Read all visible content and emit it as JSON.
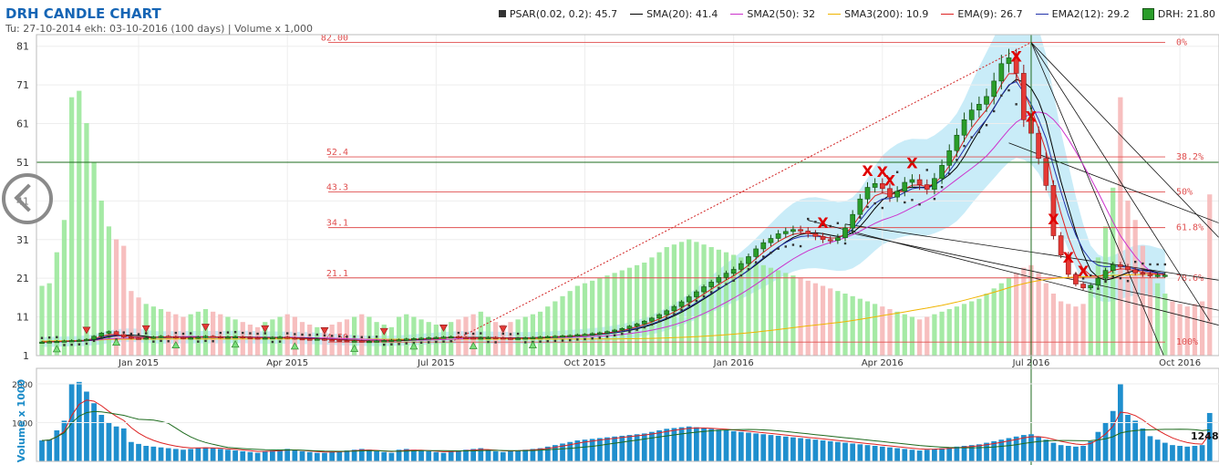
{
  "title": "DRH CANDLE CHART",
  "subtitle": "Tu: 27-10-2014 ekh: 03-10-2016 (100 days) | Volume x 1,000",
  "legend": [
    {
      "label": "PSAR(0.02, 0.2): 45.7",
      "color": "#333333",
      "icon": "square-icon"
    },
    {
      "label": "SMA(20): 41.4",
      "color": "#000000",
      "icon": "line-icon"
    },
    {
      "label": "SMA2(50): 32",
      "color": "#cc33cc",
      "icon": "line-icon"
    },
    {
      "label": "SMA3(200): 10.9",
      "color": "#f0b400",
      "icon": "line-icon"
    },
    {
      "label": "EMA(9): 26.7",
      "color": "#dd2222",
      "icon": "line-icon"
    },
    {
      "label": "EMA2(12): 29.2",
      "color": "#2233aa",
      "icon": "line-icon"
    },
    {
      "label": "DRH: 21.80",
      "color": "#2a9d2a",
      "icon": "candle-box-icon"
    }
  ],
  "colors": {
    "up": "#2a9d2a",
    "down": "#e53935",
    "vol_up": "#9be89b",
    "vol_down": "#f6b8b8",
    "band": "#c9ecf8",
    "fib": "#e05050",
    "volbar": "#1f8fce"
  },
  "chart_data": {
    "type": "candlestick",
    "y_ticks": [
      1,
      11,
      21,
      31,
      41,
      51,
      61,
      71,
      81
    ],
    "ylim": [
      1,
      84
    ],
    "x_ticks": [
      {
        "label": "Jan 2015",
        "i": 13
      },
      {
        "label": "Apr 2015",
        "i": 33
      },
      {
        "label": "Jul 2015",
        "i": 53
      },
      {
        "label": "Oct 2015",
        "i": 73
      },
      {
        "label": "Jan 2016",
        "i": 93
      },
      {
        "label": "Apr 2016",
        "i": 113
      },
      {
        "label": "Jul 2016",
        "i": 133
      },
      {
        "label": "Oct 2016",
        "i": 153
      }
    ],
    "fib_levels": [
      {
        "value": 82.0,
        "left": "82.00",
        "right": "0%"
      },
      {
        "value": 52.4,
        "left": "52.4",
        "right": "38.2%"
      },
      {
        "value": 43.3,
        "left": "43.3",
        "right": "50%"
      },
      {
        "value": 34.1,
        "left": "34.1",
        "right": "61.8%"
      },
      {
        "value": 21.1,
        "left": "21.1",
        "right": "78.6%"
      },
      {
        "value": 4.5,
        "left": "4.50",
        "right": "100%"
      }
    ],
    "crosshair": {
      "i": 133,
      "value": 51
    },
    "last_volume_label": "1248",
    "vol_ticks": [
      "1000",
      "2000"
    ],
    "vol_ylim": [
      0,
      2400
    ],
    "closes": [
      4.5,
      4.6,
      4.7,
      4.8,
      4.9,
      5.0,
      5.2,
      6.0,
      6.8,
      7.2,
      6.4,
      5.8,
      5.5,
      5.4,
      5.6,
      5.8,
      6.0,
      5.9,
      5.7,
      5.5,
      5.6,
      5.8,
      6.0,
      5.9,
      5.7,
      5.8,
      5.9,
      5.7,
      5.6,
      5.5,
      5.6,
      5.7,
      5.8,
      5.6,
      5.4,
      5.3,
      5.2,
      5.3,
      5.1,
      5.0,
      4.9,
      4.8,
      4.8,
      4.7,
      4.7,
      4.8,
      4.9,
      5.0,
      5.1,
      5.3,
      5.4,
      5.5,
      5.6,
      5.7,
      5.8,
      5.9,
      5.7,
      5.6,
      5.5,
      5.6,
      5.7,
      5.6,
      5.5,
      5.4,
      5.5,
      5.6,
      5.7,
      5.8,
      5.9,
      6.0,
      6.1,
      6.2,
      6.4,
      6.5,
      6.7,
      6.9,
      7.2,
      7.6,
      8.0,
      8.6,
      9.2,
      9.9,
      10.7,
      11.6,
      12.6,
      13.7,
      14.9,
      16.2,
      17.5,
      18.8,
      20.0,
      21.2,
      22.3,
      23.3,
      24.8,
      26.6,
      28.6,
      30.2,
      31.3,
      32.5,
      33.1,
      33.6,
      33.2,
      32.5,
      31.8,
      31.0,
      30.8,
      31.5,
      34.0,
      37.5,
      41.5,
      44.5,
      45.5,
      44.2,
      42.0,
      43.5,
      45.8,
      46.5,
      45.2,
      44.0,
      46.8,
      50.2,
      54.0,
      58.0,
      62.0,
      64.5,
      66.0,
      68.0,
      72.0,
      76.5,
      78.0,
      74.0,
      62.0,
      58.5,
      52.0,
      45.0,
      32.0,
      27.0,
      22.0,
      19.5,
      18.5,
      19.2,
      21.0,
      23.0,
      24.5,
      24.0,
      23.2,
      22.4,
      22.0,
      21.8,
      21.8,
      21.8
    ],
    "volumes": [
      540,
      560,
      800,
      1050,
      2000,
      2050,
      1800,
      1500,
      1200,
      1000,
      900,
      850,
      500,
      450,
      400,
      380,
      360,
      340,
      320,
      300,
      320,
      340,
      360,
      340,
      320,
      300,
      280,
      260,
      240,
      220,
      260,
      280,
      300,
      320,
      300,
      260,
      240,
      220,
      220,
      240,
      260,
      280,
      300,
      320,
      300,
      260,
      240,
      220,
      300,
      320,
      300,
      280,
      260,
      240,
      220,
      260,
      280,
      300,
      320,
      340,
      300,
      260,
      240,
      260,
      280,
      300,
      320,
      340,
      380,
      420,
      460,
      500,
      540,
      560,
      580,
      600,
      620,
      640,
      660,
      680,
      700,
      720,
      760,
      800,
      840,
      860,
      880,
      900,
      880,
      860,
      840,
      820,
      800,
      780,
      760,
      740,
      720,
      700,
      680,
      660,
      640,
      620,
      600,
      580,
      560,
      540,
      520,
      500,
      480,
      460,
      440,
      420,
      400,
      380,
      360,
      340,
      320,
      300,
      280,
      300,
      320,
      340,
      360,
      380,
      400,
      420,
      440,
      480,
      520,
      560,
      600,
      640,
      680,
      700,
      640,
      560,
      480,
      420,
      400,
      380,
      400,
      520,
      760,
      1000,
      1300,
      2000,
      1200,
      1050,
      850,
      650,
      560,
      480,
      420,
      400,
      380,
      400,
      420,
      1248
    ]
  }
}
